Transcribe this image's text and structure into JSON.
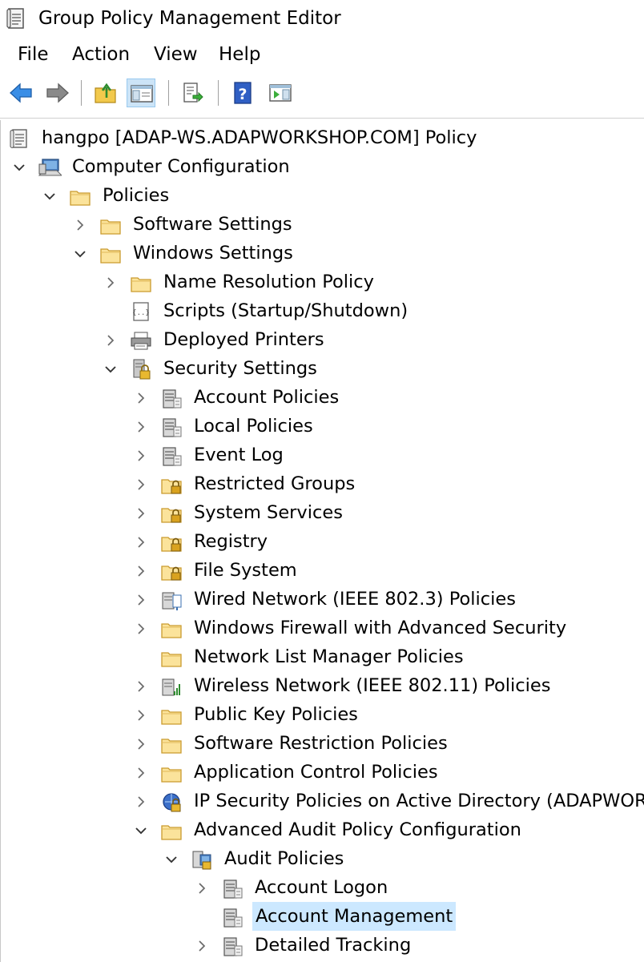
{
  "window": {
    "title": "Group Policy Management Editor"
  },
  "menu": {
    "file": "File",
    "action": "Action",
    "view": "View",
    "help": "Help"
  },
  "toolbar": {
    "buttons": [
      "back-icon",
      "forward-icon",
      "up-folder-icon",
      "show-hide-tree-icon",
      "export-list-icon",
      "help-icon",
      "show-hide-action-pane-icon"
    ],
    "pressed": "show-hide-tree-icon"
  },
  "tree": [
    {
      "label": "hangpo [ADAP-WS.ADAPWORKSHOP.COM] Policy",
      "expand": "none",
      "icon": "policy-scroll-icon"
    },
    {
      "label": "Computer Configuration",
      "expand": "expanded",
      "icon": "computer-icon"
    },
    {
      "label": "Policies",
      "expand": "expanded",
      "icon": "folder-icon"
    },
    {
      "label": "Software Settings",
      "expand": "collapsed",
      "icon": "folder-icon"
    },
    {
      "label": "Windows Settings",
      "expand": "expanded",
      "icon": "folder-icon"
    },
    {
      "label": "Name Resolution Policy",
      "expand": "collapsed",
      "icon": "folder-icon"
    },
    {
      "label": "Scripts (Startup/Shutdown)",
      "expand": "none",
      "icon": "script-icon"
    },
    {
      "label": "Deployed Printers",
      "expand": "collapsed",
      "icon": "printer-icon"
    },
    {
      "label": "Security Settings",
      "expand": "expanded",
      "icon": "security-lock-icon"
    },
    {
      "label": "Account Policies",
      "expand": "collapsed",
      "icon": "policy-server-icon"
    },
    {
      "label": "Local Policies",
      "expand": "collapsed",
      "icon": "policy-server-icon"
    },
    {
      "label": "Event Log",
      "expand": "collapsed",
      "icon": "policy-server-icon"
    },
    {
      "label": "Restricted Groups",
      "expand": "collapsed",
      "icon": "locked-folder-icon"
    },
    {
      "label": "System Services",
      "expand": "collapsed",
      "icon": "locked-folder-icon"
    },
    {
      "label": "Registry",
      "expand": "collapsed",
      "icon": "locked-folder-icon"
    },
    {
      "label": "File System",
      "expand": "collapsed",
      "icon": "locked-folder-icon"
    },
    {
      "label": "Wired Network (IEEE 802.3) Policies",
      "expand": "collapsed",
      "icon": "wired-network-icon"
    },
    {
      "label": "Windows Firewall with Advanced Security",
      "expand": "collapsed",
      "icon": "folder-icon"
    },
    {
      "label": "Network List Manager Policies",
      "expand": "none",
      "icon": "folder-icon"
    },
    {
      "label": "Wireless Network (IEEE 802.11) Policies",
      "expand": "collapsed",
      "icon": "wireless-network-icon"
    },
    {
      "label": "Public Key Policies",
      "expand": "collapsed",
      "icon": "folder-icon"
    },
    {
      "label": "Software Restriction Policies",
      "expand": "collapsed",
      "icon": "folder-icon"
    },
    {
      "label": "Application Control Policies",
      "expand": "collapsed",
      "icon": "folder-icon"
    },
    {
      "label": "IP Security Policies on Active Directory (ADAPWORKS",
      "expand": "collapsed",
      "icon": "ip-security-icon"
    },
    {
      "label": "Advanced Audit Policy Configuration",
      "expand": "expanded",
      "icon": "folder-icon"
    },
    {
      "label": "Audit Policies",
      "expand": "expanded",
      "icon": "audit-policies-icon"
    },
    {
      "label": "Account Logon",
      "expand": "collapsed",
      "icon": "policy-server-icon"
    },
    {
      "label": "Account Management",
      "expand": "none",
      "icon": "policy-server-icon",
      "selected": true
    },
    {
      "label": "Detailed Tracking",
      "expand": "collapsed",
      "icon": "policy-server-icon"
    }
  ]
}
